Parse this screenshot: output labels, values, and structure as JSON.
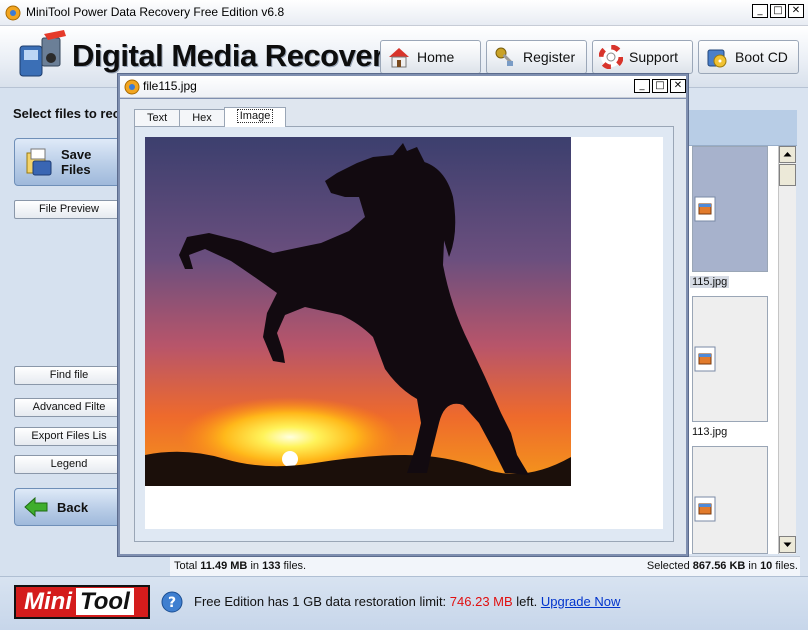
{
  "window": {
    "title": "MiniTool Power Data Recovery Free Edition v6.8",
    "controls": [
      "_",
      "□",
      "✕"
    ]
  },
  "header": {
    "brand": "Digital Media Recovery",
    "buttons": [
      {
        "label": "Home",
        "icon": "home-icon"
      },
      {
        "label": "Register",
        "icon": "key-icon"
      },
      {
        "label": "Support",
        "icon": "lifebuoy-icon"
      },
      {
        "label": "Boot CD",
        "icon": "boot-cd-icon"
      }
    ]
  },
  "left_panel": {
    "prompt": "Select files to rec",
    "save_files": "Save Files",
    "file_preview": "File Preview",
    "find_file": "Find file",
    "advanced_filter": "Advanced Filte",
    "export_files_list": "Export Files Lis",
    "legend": "Legend",
    "back": "Back"
  },
  "files": [
    {
      "label": "115.jpg",
      "selected": true
    },
    {
      "label": "113.jpg",
      "selected": false
    },
    {
      "label": "",
      "selected": false
    }
  ],
  "status": {
    "total_prefix": "Total ",
    "total_size": "11.49 MB",
    "total_in": " in ",
    "total_count": "133",
    "total_suffix": " files.",
    "selected_prefix": "Selected ",
    "selected_size": "867.56 KB",
    "selected_in": " in ",
    "selected_count": "10",
    "selected_suffix": " files."
  },
  "footer": {
    "logo_mini": "Mini",
    "logo_tool": "Tool",
    "text_prefix": "Free Edition has 1 GB data restoration limit: ",
    "limit_left": "746.23 MB",
    "text_suffix": " left. ",
    "upgrade_link": "Upgrade Now"
  },
  "dialog": {
    "title": "file115.jpg",
    "controls": [
      "_",
      "□",
      "✕"
    ],
    "tabs": [
      "Text",
      "Hex",
      "Image"
    ],
    "active_tab": "Image"
  },
  "colors": {
    "accent_red": "#e01010",
    "link_blue": "#0033cc",
    "selected_thumb": "#a7b2cc"
  }
}
